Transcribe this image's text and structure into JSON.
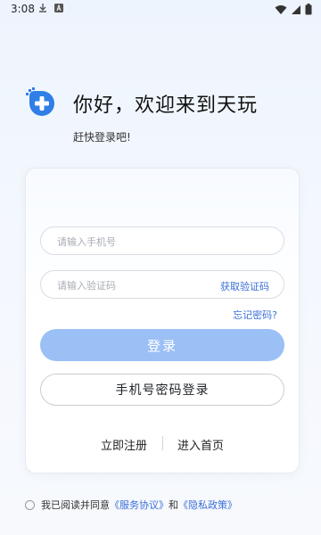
{
  "status_bar": {
    "time": "3:08"
  },
  "welcome": {
    "title": "你好，欢迎来到天玩",
    "subtitle": "赶快登录吧!"
  },
  "form": {
    "phone_placeholder": "请输入手机号",
    "code_placeholder": "请输入验证码",
    "get_code_label": "获取验证码",
    "forgot_label": "忘记密码?",
    "login_label": "登录",
    "password_login_label": "手机号密码登录",
    "register_label": "立即注册",
    "home_label": "进入首页"
  },
  "agreement": {
    "prefix": "我已阅读并同意",
    "service_link": "《服务协议》",
    "conjunction": "和",
    "privacy_link": "《隐私政策》"
  },
  "colors": {
    "accent": "#3b6fd8",
    "login_button": "#9bc0f5",
    "logo": "#2f7fe6"
  }
}
